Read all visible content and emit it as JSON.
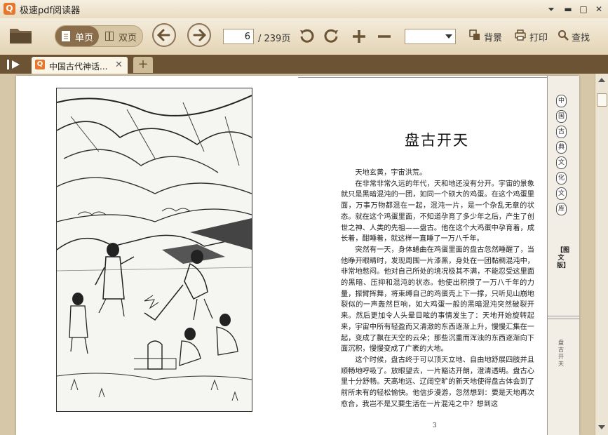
{
  "app": {
    "title": "极速pdf阅读器",
    "logo_char": "Q"
  },
  "window_controls": [
    {
      "name": "menu",
      "glyph": "⏷"
    },
    {
      "name": "minimize",
      "glyph": "▬"
    },
    {
      "name": "maximize",
      "glyph": "□"
    },
    {
      "name": "close",
      "glyph": "✕"
    }
  ],
  "toolbar": {
    "single_label": "单页",
    "double_label": "双页",
    "page_current": "6",
    "page_total": "/ 239页",
    "zoom_value": "",
    "background_label": "背景",
    "print_label": "打印",
    "find_label": "查找"
  },
  "tabs": [
    {
      "title": "中国古代神话...",
      "close": "✕"
    }
  ],
  "new_tab_label": "+",
  "page": {
    "chapter_title": "盘古开天",
    "paragraphs": [
      "天地玄黄，宇宙洪荒。",
      "在非常非常久远的年代，天和地还没有分开。宇宙的景象就只是黑暗混沌的一团，如同一个硕大的鸡蛋。在这个鸡蛋里面，万事万物都混在一起，混沌一片，是一个杂乱无章的状态。就在这个鸡蛋里面，不知道孕育了多少年之后，产生了创世之神、人类的先祖——盘古。他在这个大鸡蛋中孕育着，成长着，酣睡着，就这样一直睡了一万八千年。",
      "突然有一天，身体蜷曲在鸡蛋里面的盘古忽然睡醒了，当他睁开眼睛时，发现周围一片漆黑，身处在一团黏稠混沌中，非常地憋闷。他对自己所处的境况极其不满，不能忍受这里面的黑暗、压抑和混沌的状态。他使出积攒了一万八千年的力量，振臂挥舞，将束缚自己的鸡蛋壳上下一撑，只听见山崩地裂似的一声轰然巨响，如大鸡蛋一般的黑暗混沌突然破裂开来。然后更加令人头晕目眩的事情发生了：天地开始旋转起来，宇宙中所有轻盈而又清澈的东西逐渐上升，慢慢汇集在一起，变成了飘在天空的云朵；那些沉重而浑浊的东西逐渐向下面沉积，慢慢变成了广袤的大地。",
      "这个时候，盘古终于可以顶天立地、自由地舒展四肢并且顺畅地呼吸了。放眼望去，一片豁达开朗，澄清透明。盘古心里十分舒畅。天高地远、辽阔空旷的新天地使得盘古体会到了前所未有的轻松愉快。他信步漫游，忽然想到：要是天地再次愈合，我岂不是又要生活在一片混沌之中？想到这"
    ],
    "page_number": "3",
    "series_title": [
      "中",
      "国",
      "古",
      "典",
      "文",
      "化",
      "文",
      "库"
    ],
    "edition": "【图文版】",
    "side_chapter": "盘古开天"
  }
}
